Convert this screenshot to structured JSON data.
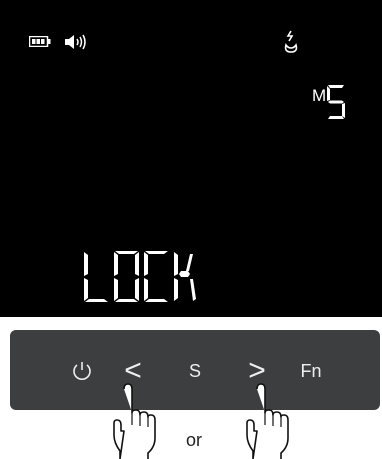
{
  "status": {
    "battery_icon": "battery-icon",
    "speaker_icon": "speaker-icon",
    "flame_icon": "flame-icon"
  },
  "display": {
    "mode_prefix": "M",
    "mode_value": "5",
    "main_text": "LOCK"
  },
  "controls": {
    "power_icon": "power-icon",
    "prev_label": "<",
    "select_label": "S",
    "next_label": ">",
    "fn_label": "Fn"
  },
  "instruction": {
    "or_text": "or",
    "finger_icon": "pointing-hand-icon"
  },
  "colors": {
    "screen_bg": "#000000",
    "panel_bg": "#3d3e3f",
    "segment_color": "#ffffff"
  }
}
